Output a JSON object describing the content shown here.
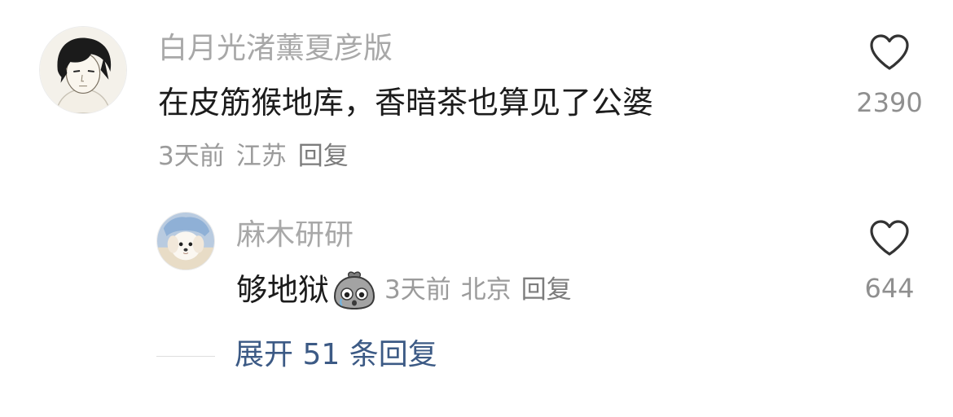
{
  "comments": [
    {
      "username": "白月光渚薰夏彦版",
      "content": "在皮筋猴地库，香暗茶也算见了公婆",
      "time": "3天前",
      "location": "江苏",
      "reply_label": "回复",
      "like_count": "2390",
      "avatar_icon": "anime-character-avatar"
    },
    {
      "username": "麻木研研",
      "content": "够地狱",
      "sticker_icon": "crying-bag-emoji",
      "time": "3天前",
      "location": "北京",
      "reply_label": "回复",
      "like_count": "644",
      "avatar_icon": "puppy-avatar"
    }
  ],
  "expand_replies_label": "展开 51 条回复",
  "colors": {
    "username": "#a8a8a8",
    "content": "#1c1c1c",
    "meta": "#9b9b9b",
    "link": "#3c5a85"
  }
}
